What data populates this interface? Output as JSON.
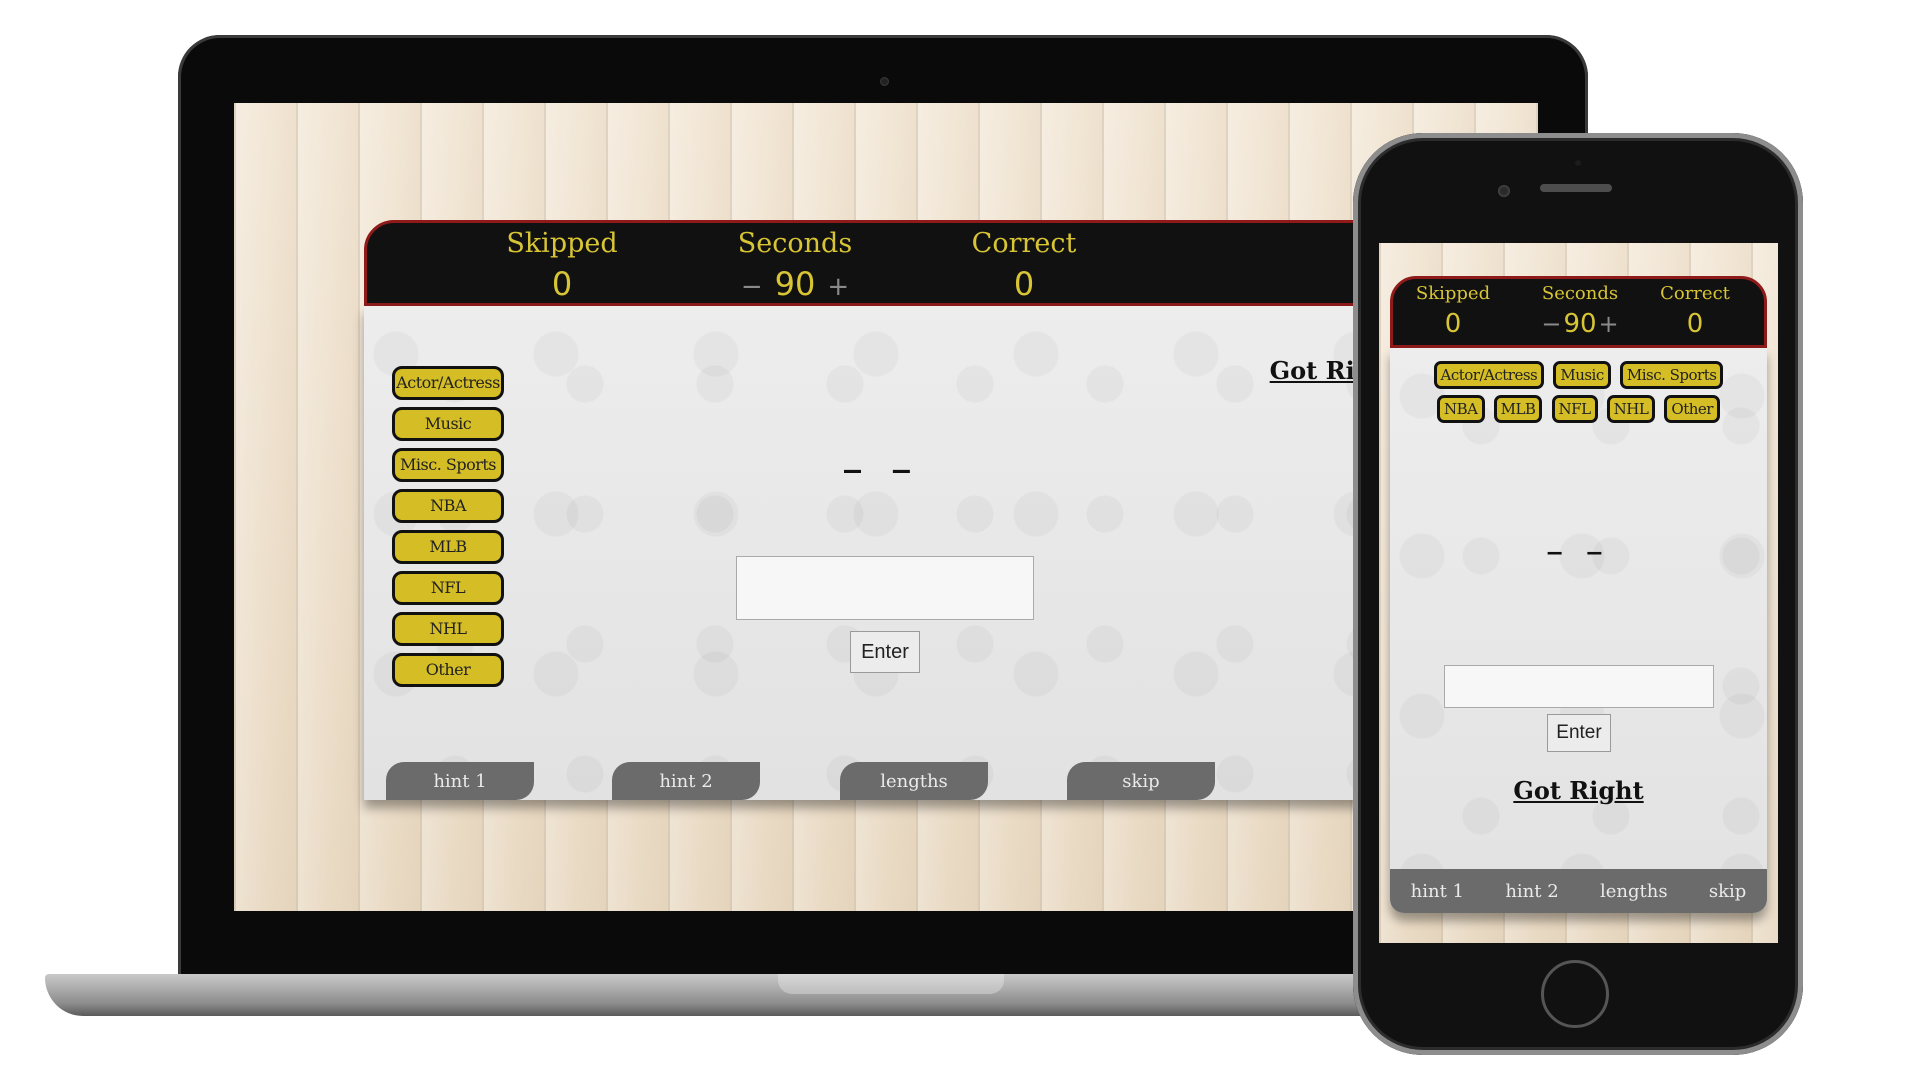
{
  "laptop_app": {
    "stats": {
      "skipped": {
        "label": "Skipped",
        "value": "0"
      },
      "seconds": {
        "label": "Seconds",
        "value": "90",
        "decrement": "−",
        "increment": "+"
      },
      "correct": {
        "label": "Correct",
        "value": "0"
      }
    },
    "categories": [
      "Actor/Actress",
      "Music",
      "Misc. Sports",
      "NBA",
      "MLB",
      "NFL",
      "NHL",
      "Other"
    ],
    "got_right": "Got Right",
    "answer_mask": "_ _",
    "guess_input": {
      "value": "",
      "placeholder": ""
    },
    "enter_label": "Enter",
    "tabs": [
      "hint 1",
      "hint 2",
      "lengths",
      "skip"
    ]
  },
  "phone_app": {
    "stats": {
      "skipped": {
        "label": "Skipped",
        "value": "0"
      },
      "seconds": {
        "label": "Seconds",
        "value": "90",
        "decrement": "−",
        "increment": "+"
      },
      "correct": {
        "label": "Correct",
        "value": "0"
      }
    },
    "categories": [
      "Actor/Actress",
      "Music",
      "Misc. Sports",
      "NBA",
      "MLB",
      "NFL",
      "NHL",
      "Other"
    ],
    "answer_mask": "_ _",
    "guess_input": {
      "value": "",
      "placeholder": ""
    },
    "enter_label": "Enter",
    "got_right": "Got Right",
    "tabs": [
      "hint 1",
      "hint 2",
      "lengths",
      "skip"
    ]
  },
  "colors": {
    "header_bg": "#111111",
    "header_border": "#8e1a1a",
    "accent_yellow": "#d8c535",
    "category_button": "#d4bd25",
    "tab_bg": "#6b6b6b"
  }
}
